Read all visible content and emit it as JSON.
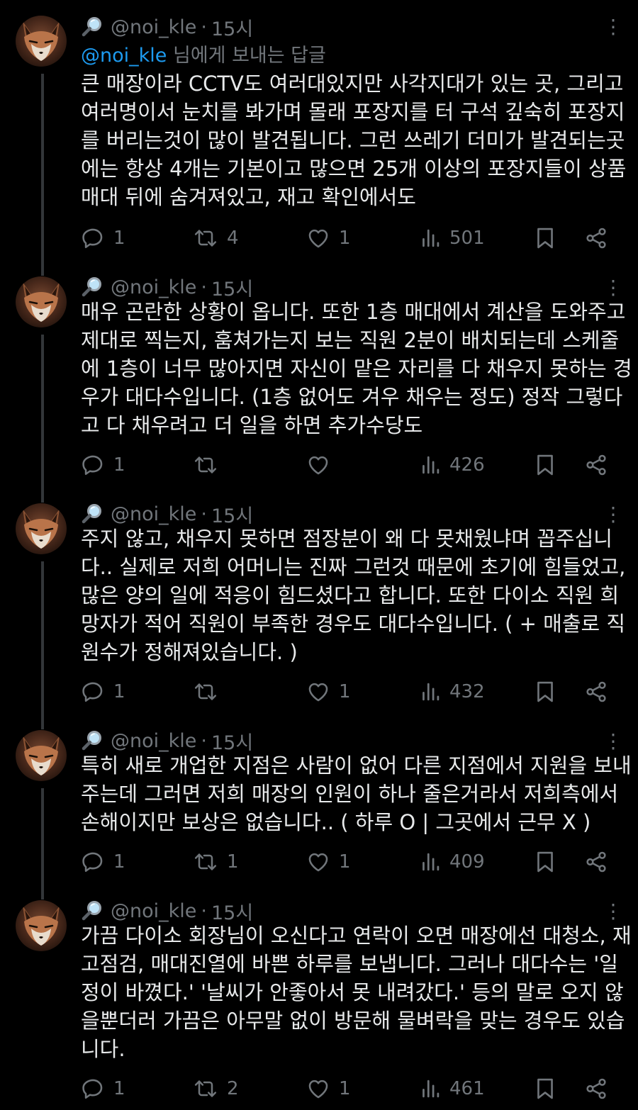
{
  "tweets": [
    {
      "handle": "@noi_kle",
      "separator": "·",
      "time": "15시",
      "reply_prefix": "@noi_kle",
      "reply_suffix": " 님에게 보내는 답글",
      "lines": [
        "큰 매장이라 CCTV도 여러대있지만 사각지대가 있는 곳, 그리고",
        "여러명이서 눈치를 봐가며 몰래 포장지를 터 구석 깊숙히 포장지",
        "를 버리는것이 많이 발견됩니다. 그런 쓰레기 더미가 발견되는곳",
        "에는 항상 4개는 기본이고 많으면 25개 이상의 포장지들이 상품",
        "매대 뒤에 숨겨져있고, 재고 확인에서도"
      ],
      "replies": "1",
      "retweets": "4",
      "likes": "1",
      "views": "501"
    },
    {
      "handle": "@noi_kle",
      "separator": "·",
      "time": "15시",
      "lines": [
        "매우 곤란한 상황이 옵니다. 또한 1층 매대에서 계산을 도와주고",
        "제대로 찍는지, 훔쳐가는지 보는 직원 2분이 배치되는데 스케줄",
        "에 1층이 너무 많아지면 자신이 맡은 자리를 다 채우지 못하는 경",
        "우가 대다수입니다. (1층 없어도 겨우 채우는 정도) 정작 그렇다",
        "고 다 채우려고 더 일을 하면 추가수당도"
      ],
      "replies": "1",
      "retweets": "",
      "likes": "",
      "views": "426"
    },
    {
      "handle": "@noi_kle",
      "separator": "·",
      "time": "15시",
      "lines": [
        "주지 않고, 채우지 못하면 점장분이 왜 다 못채웠냐며 꼽주십니",
        "다.. 실제로 저희 어머니는 진짜 그런것 때문에 초기에 힘들었고,",
        "많은 양의 일에 적응이 힘드셨다고 합니다. 또한 다이소 직원 희",
        "망자가 적어 직원이 부족한 경우도 대다수입니다. ( + 매출로 직",
        "원수가 정해져있습니다. )"
      ],
      "replies": "1",
      "retweets": "",
      "likes": "1",
      "views": "432"
    },
    {
      "handle": "@noi_kle",
      "separator": "·",
      "time": "15시",
      "lines": [
        "특히 새로 개업한 지점은 사람이 없어 다른 지점에서 지원을 보내",
        "주는데 그러면 저희 매장의 인원이 하나 줄은거라서 저희측에서",
        "손해이지만 보상은 없습니다.. ( 하루 O | 그곳에서 근무 X )"
      ],
      "replies": "1",
      "retweets": "1",
      "likes": "1",
      "views": "409"
    },
    {
      "handle": "@noi_kle",
      "separator": "·",
      "time": "15시",
      "lines": [
        "가끔 다이소 회장님이 오신다고 연락이 오면 매장에선 대청소, 재",
        "고점검, 매대진열에 바쁜 하루를 보냅니다. 그러나 대다수는 '일",
        "정이 바꼈다.' '날씨가 안좋아서 못 내려갔다.' 등의 말로 오지 않",
        "을뿐더러 가끔은 아무말 없이 방문해 물벼락을 맞는 경우도 있습",
        "니다."
      ],
      "replies": "1",
      "retweets": "2",
      "likes": "1",
      "views": "461"
    }
  ],
  "icons": {
    "header_emoji": "magnifying-glass-icon",
    "more": "more-dots-icon",
    "reply": "reply-icon",
    "retweet": "retweet-icon",
    "like": "heart-icon",
    "views": "views-chart-icon",
    "bookmark": "bookmark-icon",
    "share": "share-icon"
  },
  "colors": {
    "background": "#000000",
    "text": "#e7e9ea",
    "muted": "#71767b",
    "mention": "#1d9bf0"
  }
}
